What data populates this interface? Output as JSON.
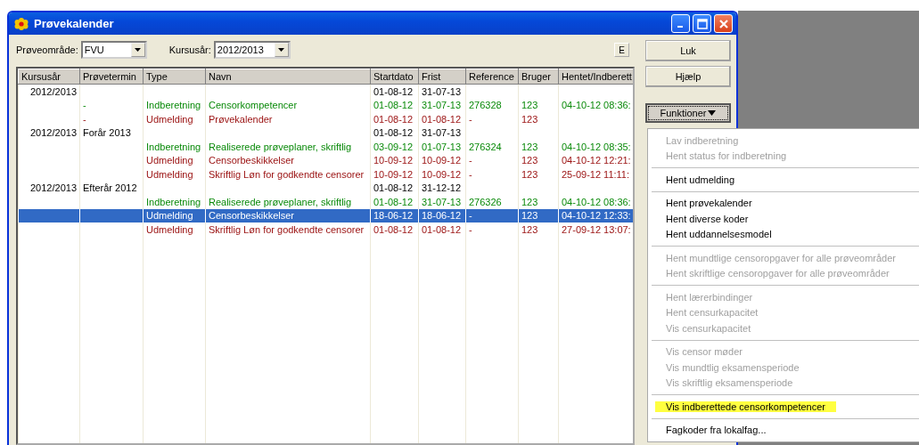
{
  "window": {
    "title": "Prøvekalender"
  },
  "filters": [
    {
      "label": "Prøveområde:",
      "value": "FVU"
    },
    {
      "label": "Kursusår:",
      "value": "2012/2013"
    }
  ],
  "small_button": "E",
  "table": {
    "columns": [
      "Kursusår",
      "Prøvetermin",
      "Type",
      "Navn",
      "Startdato",
      "Frist",
      "Reference",
      "Bruger",
      "Hentet/Indberett"
    ],
    "rows": [
      {
        "kind": "group",
        "selected": false,
        "cells": [
          "2012/2013",
          "",
          "",
          "",
          "01-08-12",
          "31-07-13",
          "",
          "",
          ""
        ]
      },
      {
        "kind": "report",
        "selected": false,
        "cells": [
          "",
          "-",
          "Indberetning",
          "Censorkompetencer",
          "01-08-12",
          "31-07-13",
          "276328",
          "123",
          "04-10-12 08:36:"
        ]
      },
      {
        "kind": "notice",
        "selected": false,
        "cells": [
          "",
          "-",
          "Udmelding",
          "Prøvekalender",
          "01-08-12",
          "01-08-12",
          "-",
          "123",
          ""
        ]
      },
      {
        "kind": "group",
        "selected": false,
        "cells": [
          "2012/2013",
          "Forår 2013",
          "",
          "",
          "01-08-12",
          "31-07-13",
          "",
          "",
          ""
        ]
      },
      {
        "kind": "report",
        "selected": false,
        "cells": [
          "",
          "",
          "Indberetning",
          "Realiserede prøveplaner, skriftlig",
          "03-09-12",
          "01-07-13",
          "276324",
          "123",
          "04-10-12 08:35:"
        ]
      },
      {
        "kind": "notice",
        "selected": false,
        "cells": [
          "",
          "",
          "Udmelding",
          "Censorbeskikkelser",
          "10-09-12",
          "10-09-12",
          "-",
          "123",
          "04-10-12 12:21:"
        ]
      },
      {
        "kind": "notice",
        "selected": false,
        "cells": [
          "",
          "",
          "Udmelding",
          "Skriftlig Løn for godkendte censorer",
          "10-09-12",
          "10-09-12",
          "-",
          "123",
          "25-09-12 11:11:"
        ]
      },
      {
        "kind": "group",
        "selected": false,
        "cells": [
          "2012/2013",
          "Efterår 2012",
          "",
          "",
          "01-08-12",
          "31-12-12",
          "",
          "",
          ""
        ]
      },
      {
        "kind": "report",
        "selected": false,
        "cells": [
          "",
          "",
          "Indberetning",
          "Realiserede prøveplaner, skriftlig",
          "01-08-12",
          "31-07-13",
          "276326",
          "123",
          "04-10-12 08:36:"
        ]
      },
      {
        "kind": "notice",
        "selected": true,
        "cells": [
          "",
          "",
          "Udmelding",
          "Censorbeskikkelser",
          "18-06-12",
          "18-06-12",
          "-",
          "123",
          "04-10-12 12:33:"
        ]
      },
      {
        "kind": "notice",
        "selected": false,
        "cells": [
          "",
          "",
          "Udmelding",
          "Skriftlig Løn for godkendte censorer",
          "01-08-12",
          "01-08-12",
          "-",
          "123",
          "27-09-12 13:07:"
        ]
      }
    ]
  },
  "buttons": [
    "Luk",
    "Hjælp"
  ],
  "menu_button": {
    "label": "Funktioner",
    "expanded": true
  },
  "menu": {
    "groups": [
      [
        {
          "label": "Lav indberetning",
          "disabled": true,
          "highlighted": false
        },
        {
          "label": "Hent status for indberetning",
          "disabled": true,
          "highlighted": false
        }
      ],
      [
        {
          "label": "Hent udmelding",
          "disabled": false,
          "highlighted": false
        }
      ],
      [
        {
          "label": "Hent prøvekalender",
          "disabled": false,
          "highlighted": false
        },
        {
          "label": "Hent diverse koder",
          "disabled": false,
          "highlighted": false
        },
        {
          "label": "Hent uddannelsesmodel",
          "disabled": false,
          "highlighted": false
        }
      ],
      [
        {
          "label": "Hent mundtlige censoropgaver for alle prøveområder",
          "disabled": true,
          "highlighted": false
        },
        {
          "label": "Hent skriftlige censoropgaver for alle prøveområder",
          "disabled": true,
          "highlighted": false
        }
      ],
      [
        {
          "label": "Hent lærerbindinger",
          "disabled": true,
          "highlighted": false
        },
        {
          "label": "Hent censurkapacitet",
          "disabled": true,
          "highlighted": false
        },
        {
          "label": "Vis censurkapacitet",
          "disabled": true,
          "highlighted": false
        }
      ],
      [
        {
          "label": "Vis censor møder",
          "disabled": true,
          "highlighted": false
        },
        {
          "label": "Vis mundtlig eksamensperiode",
          "disabled": true,
          "highlighted": false
        },
        {
          "label": "Vis skriftlig eksamensperiode",
          "disabled": true,
          "highlighted": false
        }
      ],
      [
        {
          "label": "Vis indberettede censorkompetencer",
          "disabled": false,
          "highlighted": true
        }
      ],
      [
        {
          "label": "Fagkoder fra lokalfag...",
          "disabled": false,
          "highlighted": false
        }
      ]
    ]
  }
}
